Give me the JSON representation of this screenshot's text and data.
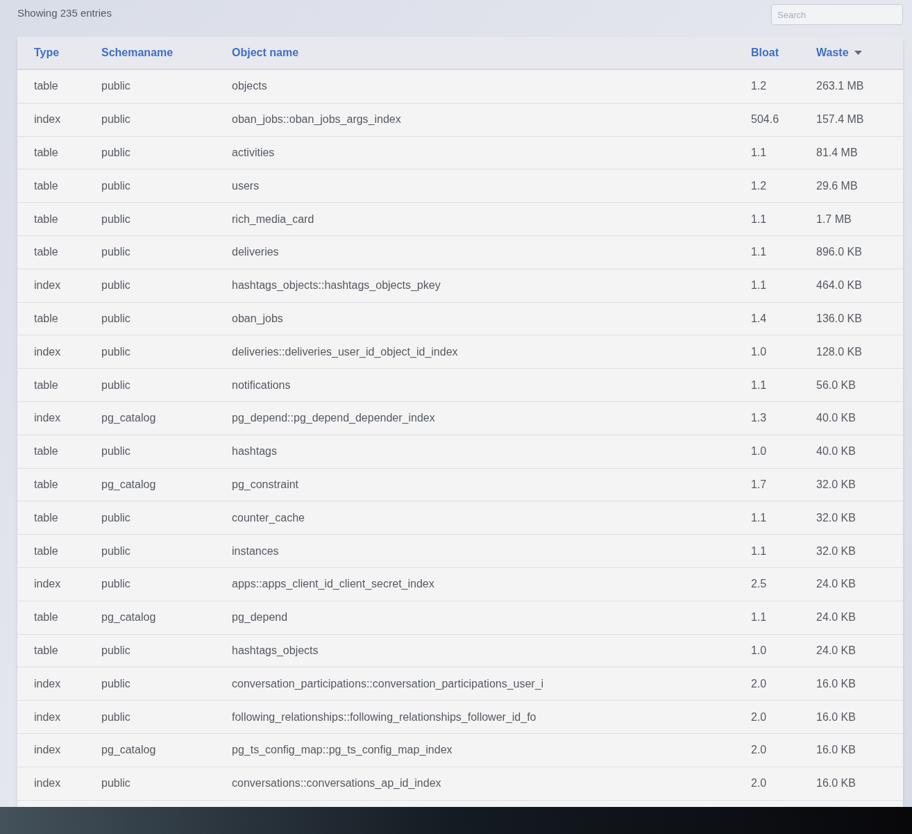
{
  "summary": "Showing 235 entries",
  "search": {
    "placeholder": "Search"
  },
  "table": {
    "columns": [
      {
        "label": "Type",
        "sorted": false
      },
      {
        "label": "Schemaname",
        "sorted": false
      },
      {
        "label": "Object name",
        "sorted": false
      },
      {
        "label": "Bloat",
        "sorted": false
      },
      {
        "label": "Waste",
        "sorted": true
      }
    ],
    "rows": [
      [
        "table",
        "public",
        "objects",
        "1.2",
        "263.1 MB"
      ],
      [
        "index",
        "public",
        "oban_jobs::oban_jobs_args_index",
        "504.6",
        "157.4 MB"
      ],
      [
        "table",
        "public",
        "activities",
        "1.1",
        "81.4 MB"
      ],
      [
        "table",
        "public",
        "users",
        "1.2",
        "29.6 MB"
      ],
      [
        "table",
        "public",
        "rich_media_card",
        "1.1",
        "1.7 MB"
      ],
      [
        "table",
        "public",
        "deliveries",
        "1.1",
        "896.0 KB"
      ],
      [
        "index",
        "public",
        "hashtags_objects::hashtags_objects_pkey",
        "1.1",
        "464.0 KB"
      ],
      [
        "table",
        "public",
        "oban_jobs",
        "1.4",
        "136.0 KB"
      ],
      [
        "index",
        "public",
        "deliveries::deliveries_user_id_object_id_index",
        "1.0",
        "128.0 KB"
      ],
      [
        "table",
        "public",
        "notifications",
        "1.1",
        "56.0 KB"
      ],
      [
        "index",
        "pg_catalog",
        "pg_depend::pg_depend_depender_index",
        "1.3",
        "40.0 KB"
      ],
      [
        "table",
        "public",
        "hashtags",
        "1.0",
        "40.0 KB"
      ],
      [
        "table",
        "pg_catalog",
        "pg_constraint",
        "1.7",
        "32.0 KB"
      ],
      [
        "table",
        "public",
        "counter_cache",
        "1.1",
        "32.0 KB"
      ],
      [
        "table",
        "public",
        "instances",
        "1.1",
        "32.0 KB"
      ],
      [
        "index",
        "public",
        "apps::apps_client_id_client_secret_index",
        "2.5",
        "24.0 KB"
      ],
      [
        "table",
        "pg_catalog",
        "pg_depend",
        "1.1",
        "24.0 KB"
      ],
      [
        "table",
        "public",
        "hashtags_objects",
        "1.0",
        "24.0 KB"
      ],
      [
        "index",
        "public",
        "conversation_participations::conversation_participations_user_i",
        "2.0",
        "16.0 KB"
      ],
      [
        "index",
        "public",
        "following_relationships::following_relationships_follower_id_fo",
        "2.0",
        "16.0 KB"
      ],
      [
        "index",
        "pg_catalog",
        "pg_ts_config_map::pg_ts_config_map_index",
        "2.0",
        "16.0 KB"
      ],
      [
        "index",
        "public",
        "conversations::conversations_ap_id_index",
        "2.0",
        "16.0 KB"
      ]
    ]
  }
}
